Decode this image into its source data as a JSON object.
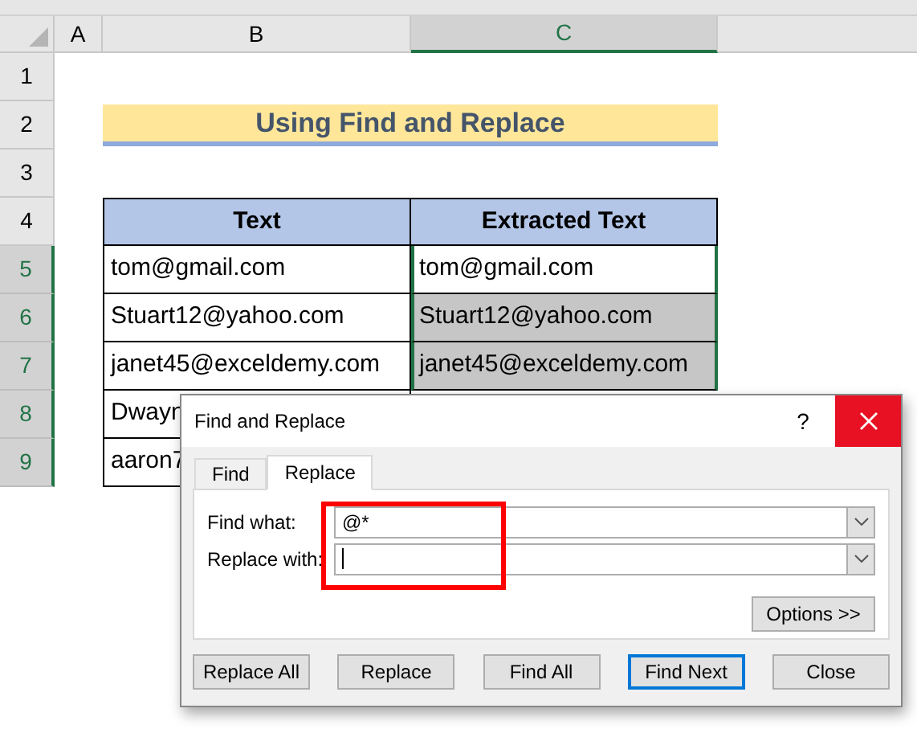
{
  "columns": [
    {
      "label": "A",
      "selected": false
    },
    {
      "label": "B",
      "selected": false
    },
    {
      "label": "C",
      "selected": true
    }
  ],
  "row_headers": [
    {
      "label": "1",
      "selected": false
    },
    {
      "label": "2",
      "selected": false
    },
    {
      "label": "3",
      "selected": false
    },
    {
      "label": "4",
      "selected": false
    },
    {
      "label": "5",
      "selected": true
    },
    {
      "label": "6",
      "selected": true
    },
    {
      "label": "7",
      "selected": true
    },
    {
      "label": "8",
      "selected": true
    },
    {
      "label": "9",
      "selected": true
    }
  ],
  "title": "Using Find and Replace",
  "table": {
    "columns": [
      "Text",
      "Extracted Text"
    ],
    "rows": [
      {
        "text": "tom@gmail.com",
        "extracted": "tom@gmail.com",
        "selected": false
      },
      {
        "text": "Stuart12@yahoo.com",
        "extracted": "Stuart12@yahoo.com",
        "selected": true
      },
      {
        "text": "janet45@exceldemy.com",
        "extracted": "janet45@exceldemy.com",
        "selected": true
      },
      {
        "text": "Dwayn"
      },
      {
        "text": "aaron7"
      }
    ]
  },
  "dialog": {
    "title": "Find and Replace",
    "help": "?",
    "tabs": [
      {
        "label": "Find",
        "selected": false
      },
      {
        "label": "Replace",
        "selected": true
      }
    ],
    "fields": [
      {
        "label": "Find what:",
        "value": "@*",
        "focused": false
      },
      {
        "label": "Replace with:",
        "focused": true
      }
    ],
    "options_button": "Options >>",
    "buttons": [
      {
        "label": "Replace All",
        "default": false
      },
      {
        "label": "Replace",
        "default": false
      },
      {
        "label": "Find All",
        "default": false
      },
      {
        "label": "Find Next",
        "default": true
      },
      {
        "label": "Close",
        "default": false
      }
    ]
  }
}
